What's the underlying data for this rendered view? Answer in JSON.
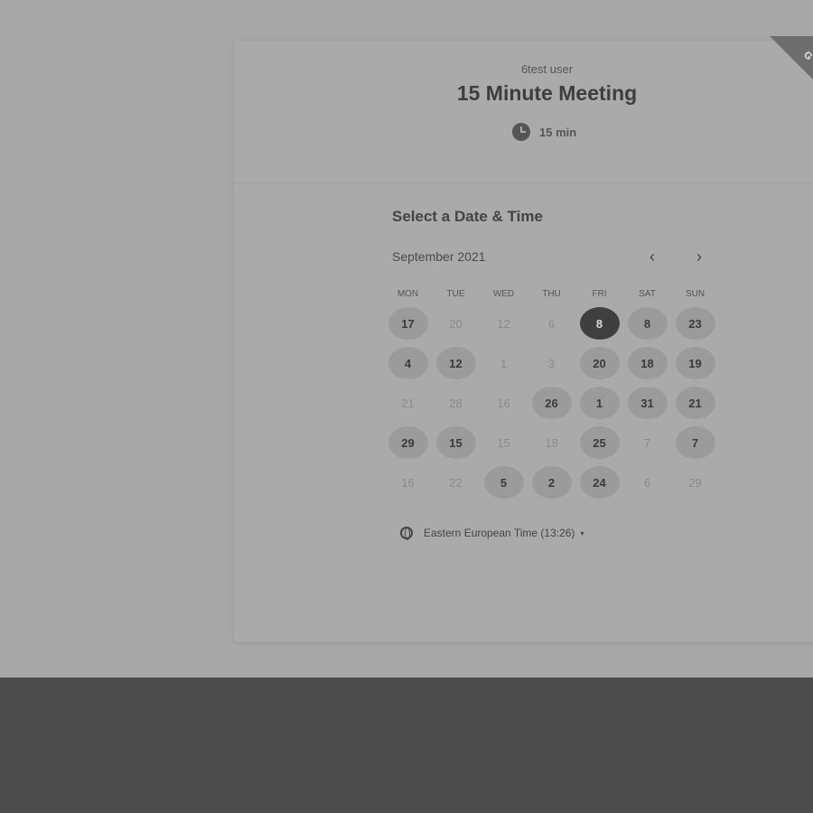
{
  "event": {
    "owner": "6test user",
    "title": "15 Minute Meeting",
    "duration": "15 min",
    "ribbon_text": "G"
  },
  "calendar": {
    "heading": "Select a Date & Time",
    "month_label": "September 2021",
    "prev_icon": "chevron-left-icon",
    "next_icon": "chevron-right-icon",
    "weekdays": [
      "MON",
      "TUE",
      "WED",
      "THU",
      "FRI",
      "SAT",
      "SUN"
    ],
    "rows": [
      [
        {
          "label": "17",
          "state": "available"
        },
        {
          "label": "20",
          "state": "unavailable"
        },
        {
          "label": "12",
          "state": "unavailable"
        },
        {
          "label": "6",
          "state": "unavailable"
        },
        {
          "label": "8",
          "state": "selected"
        },
        {
          "label": "8",
          "state": "available"
        },
        {
          "label": "23",
          "state": "available"
        }
      ],
      [
        {
          "label": "4",
          "state": "available"
        },
        {
          "label": "12",
          "state": "available"
        },
        {
          "label": "1",
          "state": "unavailable"
        },
        {
          "label": "3",
          "state": "unavailable"
        },
        {
          "label": "20",
          "state": "available"
        },
        {
          "label": "18",
          "state": "available"
        },
        {
          "label": "19",
          "state": "available"
        }
      ],
      [
        {
          "label": "21",
          "state": "unavailable"
        },
        {
          "label": "28",
          "state": "unavailable"
        },
        {
          "label": "16",
          "state": "unavailable"
        },
        {
          "label": "26",
          "state": "available"
        },
        {
          "label": "1",
          "state": "available"
        },
        {
          "label": "31",
          "state": "available"
        },
        {
          "label": "21",
          "state": "available"
        }
      ],
      [
        {
          "label": "29",
          "state": "available"
        },
        {
          "label": "15",
          "state": "available"
        },
        {
          "label": "15",
          "state": "unavailable"
        },
        {
          "label": "18",
          "state": "unavailable"
        },
        {
          "label": "25",
          "state": "available"
        },
        {
          "label": "7",
          "state": "unavailable"
        },
        {
          "label": "7",
          "state": "available"
        }
      ],
      [
        {
          "label": "16",
          "state": "unavailable"
        },
        {
          "label": "22",
          "state": "unavailable"
        },
        {
          "label": "5",
          "state": "available"
        },
        {
          "label": "2",
          "state": "available"
        },
        {
          "label": "24",
          "state": "available"
        },
        {
          "label": "6",
          "state": "unavailable"
        },
        {
          "label": "29",
          "state": "unavailable"
        }
      ]
    ]
  },
  "timezone": {
    "icon": "globe-icon",
    "label": "Eastern European Time (13:26)",
    "caret": "▾"
  }
}
